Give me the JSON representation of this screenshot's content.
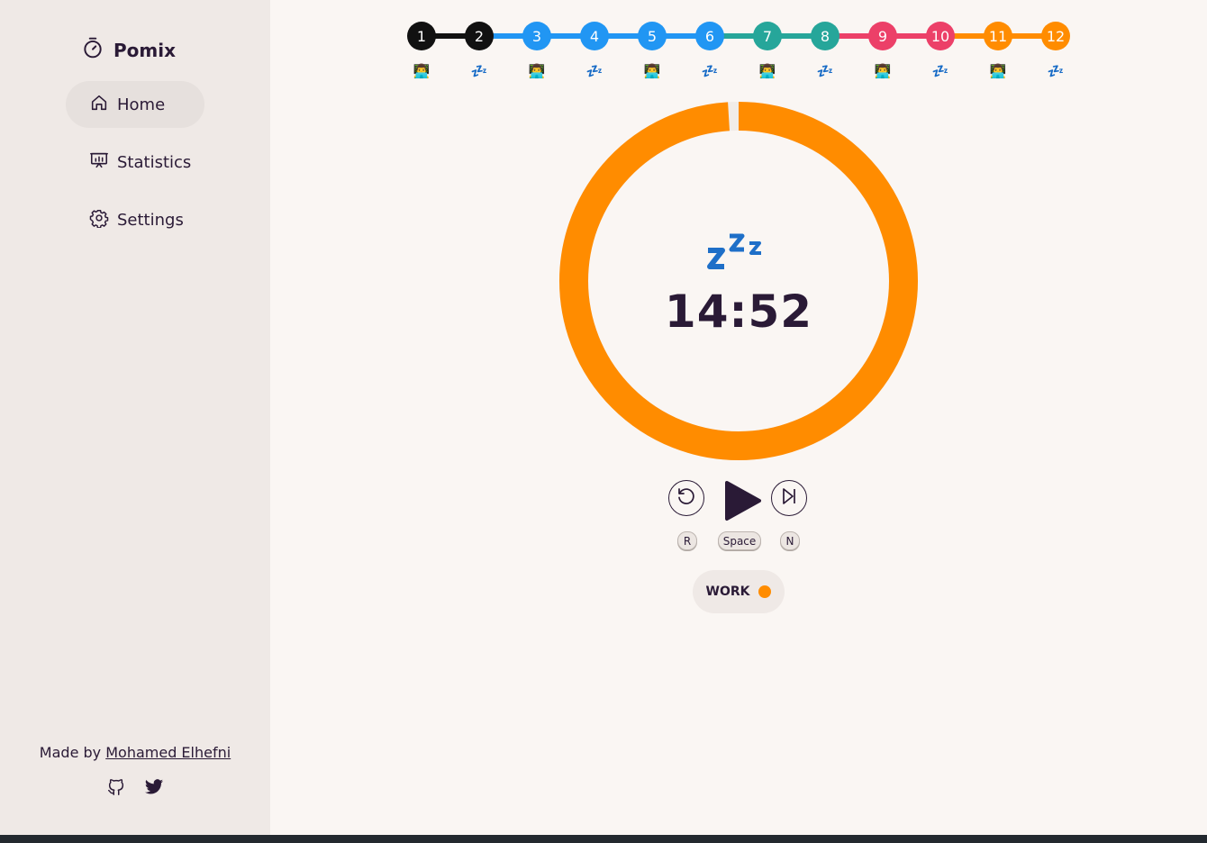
{
  "app": {
    "name": "Pomix",
    "brand_icon": "stopwatch-icon"
  },
  "sidebar": {
    "items": [
      {
        "label": "Home",
        "icon": "home-icon",
        "active": true
      },
      {
        "label": "Statistics",
        "icon": "presentation-chart-icon",
        "active": false
      },
      {
        "label": "Settings",
        "icon": "gear-icon",
        "active": false
      }
    ],
    "footer": {
      "prefix": "Made by",
      "author": "Mohamed Elhefni"
    },
    "social": [
      "github-icon",
      "twitter-icon"
    ]
  },
  "steps": [
    {
      "num": "1",
      "kind": "work",
      "color": "#111111"
    },
    {
      "num": "2",
      "kind": "break",
      "color": "#111111"
    },
    {
      "num": "3",
      "kind": "work",
      "color": "#2196f3"
    },
    {
      "num": "4",
      "kind": "break",
      "color": "#2196f3"
    },
    {
      "num": "5",
      "kind": "work",
      "color": "#2196f3"
    },
    {
      "num": "6",
      "kind": "break",
      "color": "#2196f3"
    },
    {
      "num": "7",
      "kind": "work",
      "color": "#26a69a"
    },
    {
      "num": "8",
      "kind": "break",
      "color": "#26a69a"
    },
    {
      "num": "9",
      "kind": "work",
      "color": "#ec4068"
    },
    {
      "num": "10",
      "kind": "break",
      "color": "#ec4068"
    },
    {
      "num": "11",
      "kind": "work",
      "color": "#ff8c00"
    },
    {
      "num": "12",
      "kind": "break",
      "color": "#ff8c00"
    }
  ],
  "step_emoji": {
    "work": "👨‍💻",
    "break": "💤"
  },
  "timer": {
    "time": "14:52",
    "emoji": "zzz-icon",
    "progress": 0.99,
    "ring_color": "#ff8c00"
  },
  "controls": {
    "reset_icon": "reset-icon",
    "reset_key": "R",
    "play_icon": "play-icon",
    "play_key": "Space",
    "next_icon": "skip-next-icon",
    "next_key": "N"
  },
  "mode": {
    "label": "WORK",
    "color": "#ff8c00"
  }
}
